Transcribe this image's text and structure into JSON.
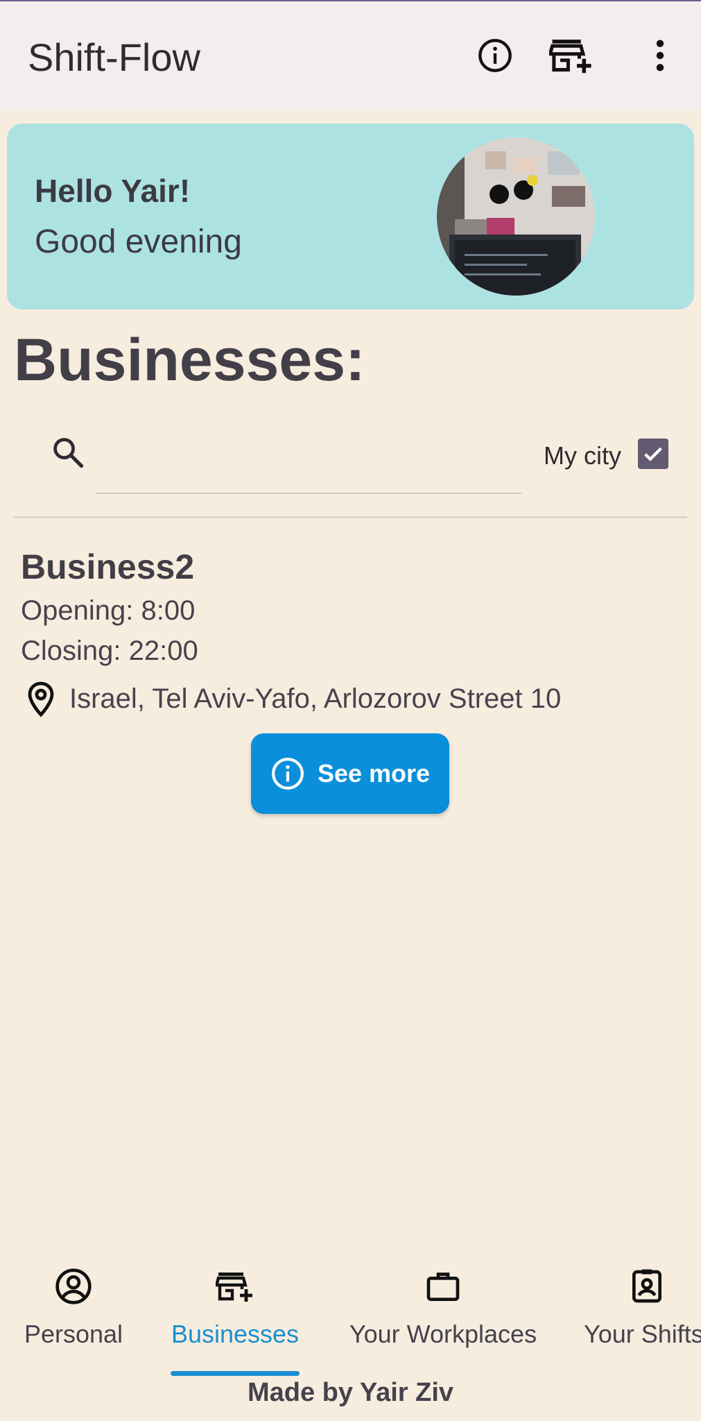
{
  "app": {
    "title": "Shift-Flow"
  },
  "toolbar": {
    "icons": [
      "info-icon",
      "add-business-icon",
      "more-vert-icon"
    ]
  },
  "greeting": {
    "hello": "Hello Yair!",
    "sub": "Good evening"
  },
  "section": {
    "title": "Businesses:"
  },
  "search": {
    "placeholder": "",
    "value": ""
  },
  "filter": {
    "my_city_label": "My city",
    "my_city_checked": true
  },
  "business": {
    "name": "Business2",
    "opening": "Opening: 8:00",
    "closing": "Closing: 22:00",
    "address": "Israel, Tel Aviv-Yafo, Arlozorov Street 10",
    "see_more_label": "See more"
  },
  "nav": {
    "items": [
      {
        "label": "Personal",
        "icon": "account-circle-icon"
      },
      {
        "label": "Businesses",
        "icon": "add-business-icon",
        "active": true
      },
      {
        "label": "Your Workplaces",
        "icon": "briefcase-icon"
      },
      {
        "label": "Your Shifts",
        "icon": "badge-icon"
      }
    ]
  },
  "footer": {
    "text": "Made by Yair Ziv"
  },
  "colors": {
    "background": "#f7eddf",
    "appbar": "#f3eeed",
    "card": "#ade2e2",
    "accent": "#0a8fdc",
    "checkbox": "#625b71"
  }
}
